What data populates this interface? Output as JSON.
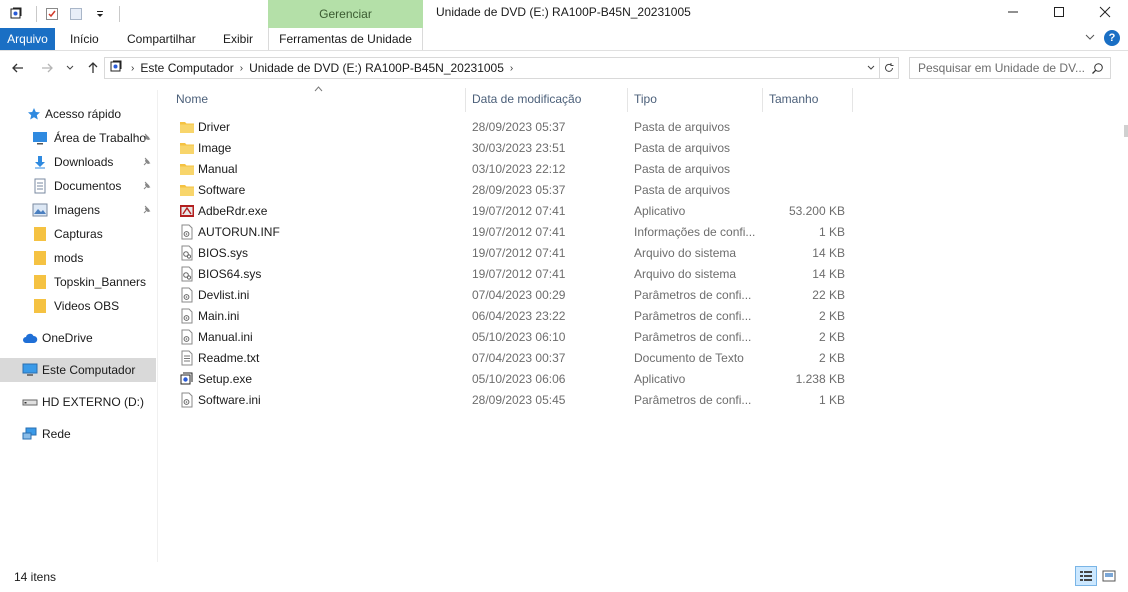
{
  "window": {
    "title": "Unidade de DVD (E:) RA100P-B45N_20231005",
    "context_group": "Gerenciar",
    "controls": {
      "minimize": "minimize-icon",
      "maximize": "maximize-icon",
      "close": "close-icon"
    }
  },
  "ribbon": {
    "tabs": [
      {
        "label": "Arquivo"
      },
      {
        "label": "Início"
      },
      {
        "label": "Compartilhar"
      },
      {
        "label": "Exibir"
      },
      {
        "label": "Ferramentas de Unidade"
      }
    ]
  },
  "address": {
    "crumbs": [
      "Este Computador",
      "Unidade de DVD (E:) RA100P-B45N_20231005"
    ],
    "search_placeholder": "Pesquisar em Unidade de DV..."
  },
  "nav": {
    "quick_access": "Acesso rápido",
    "items": [
      {
        "label": "Área de Trabalho",
        "icon": "desktop-icon",
        "pinned": true
      },
      {
        "label": "Downloads",
        "icon": "download-icon",
        "pinned": true
      },
      {
        "label": "Documentos",
        "icon": "documents-icon",
        "pinned": true
      },
      {
        "label": "Imagens",
        "icon": "pictures-icon",
        "pinned": true
      },
      {
        "label": "Capturas",
        "icon": "folder-icon",
        "pinned": false
      },
      {
        "label": "mods",
        "icon": "folder-icon",
        "pinned": false
      },
      {
        "label": "Topskin_Banners",
        "icon": "folder-icon",
        "pinned": false
      },
      {
        "label": "Videos OBS",
        "icon": "folder-icon",
        "pinned": false
      }
    ],
    "onedrive": "OneDrive",
    "this_pc": "Este Computador",
    "external": "HD EXTERNO (D:)",
    "network": "Rede"
  },
  "columns": {
    "name": "Nome",
    "date": "Data de modificação",
    "type": "Tipo",
    "size": "Tamanho"
  },
  "files": [
    {
      "name": "Driver",
      "date": "28/09/2023 05:37",
      "type": "Pasta de arquivos",
      "size": "",
      "icon": "folder-icon"
    },
    {
      "name": "Image",
      "date": "30/03/2023 23:51",
      "type": "Pasta de arquivos",
      "size": "",
      "icon": "folder-icon"
    },
    {
      "name": "Manual",
      "date": "03/10/2023 22:12",
      "type": "Pasta de arquivos",
      "size": "",
      "icon": "folder-icon"
    },
    {
      "name": "Software",
      "date": "28/09/2023 05:37",
      "type": "Pasta de arquivos",
      "size": "",
      "icon": "folder-icon"
    },
    {
      "name": "AdbeRdr.exe",
      "date": "19/07/2012 07:41",
      "type": "Aplicativo",
      "size": "53.200 KB",
      "icon": "acrobat-icon"
    },
    {
      "name": "AUTORUN.INF",
      "date": "19/07/2012 07:41",
      "type": "Informações de confi...",
      "size": "1 KB",
      "icon": "settings-file-icon"
    },
    {
      "name": "BIOS.sys",
      "date": "19/07/2012 07:41",
      "type": "Arquivo do sistema",
      "size": "14 KB",
      "icon": "system-file-icon"
    },
    {
      "name": "BIOS64.sys",
      "date": "19/07/2012 07:41",
      "type": "Arquivo do sistema",
      "size": "14 KB",
      "icon": "system-file-icon"
    },
    {
      "name": "Devlist.ini",
      "date": "07/04/2023 00:29",
      "type": "Parâmetros de confi...",
      "size": "22 KB",
      "icon": "settings-file-icon"
    },
    {
      "name": "Main.ini",
      "date": "06/04/2023 23:22",
      "type": "Parâmetros de confi...",
      "size": "2 KB",
      "icon": "settings-file-icon"
    },
    {
      "name": "Manual.ini",
      "date": "05/10/2023 06:10",
      "type": "Parâmetros de confi...",
      "size": "2 KB",
      "icon": "settings-file-icon"
    },
    {
      "name": "Readme.txt",
      "date": "07/04/2023 00:37",
      "type": "Documento de Texto",
      "size": "2 KB",
      "icon": "text-file-icon"
    },
    {
      "name": "Setup.exe",
      "date": "05/10/2023 06:06",
      "type": "Aplicativo",
      "size": "1.238 KB",
      "icon": "setup-icon"
    },
    {
      "name": "Software.ini",
      "date": "28/09/2023 05:45",
      "type": "Parâmetros de confi...",
      "size": "1 KB",
      "icon": "settings-file-icon"
    }
  ],
  "status": {
    "count": "14 itens"
  },
  "colors": {
    "accent": "#1a6fc4",
    "context_tab": "#b4e0a8",
    "folder": "#f5c242",
    "selected": "#d9d9d9"
  }
}
